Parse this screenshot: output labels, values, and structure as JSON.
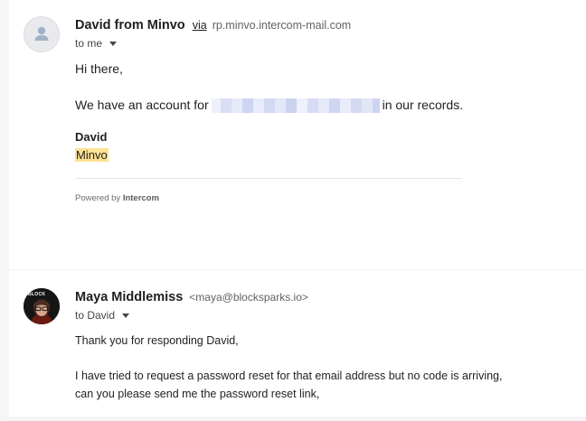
{
  "message1": {
    "sender_name": "David from Minvo",
    "via_label": "via",
    "via_domain": "rp.minvo.intercom-mail.com",
    "recipient": "to me",
    "greeting": "Hi there,",
    "line_before": "We have an account for",
    "line_after": "in our records.",
    "signature_name": "David",
    "signature_company": "Minvo",
    "powered_prefix": "Powered by",
    "powered_brand": "Intercom"
  },
  "message2": {
    "sender_name": "Maya Middlemiss",
    "sender_email": "<maya@blocksparks.io>",
    "recipient": "to David",
    "avatar_text": "BLOCK",
    "line1": "Thank you for responding David,",
    "line2": "I have tried to request a password reset for that email address but no code is arriving,",
    "line3": "can you please send me the password reset link,"
  },
  "colors": {
    "highlight": "#fde293",
    "page_background": "#f5f6f7"
  },
  "icons": {
    "default_avatar": "person-icon",
    "recipient_toggle": "caret-down-icon"
  }
}
